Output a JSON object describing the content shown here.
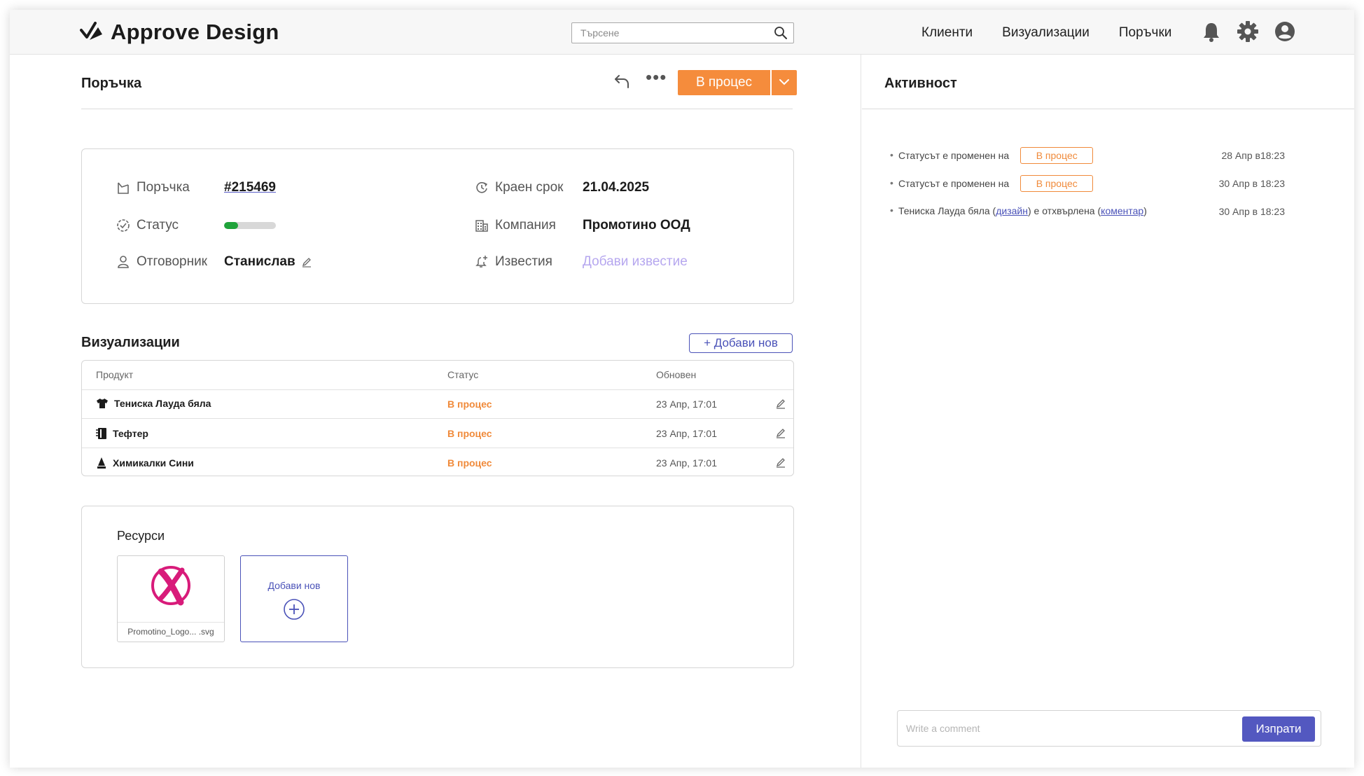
{
  "app": {
    "title": "Approve Design"
  },
  "search": {
    "placeholder": "Търсене"
  },
  "nav": [
    {
      "label": "Клиенти"
    },
    {
      "label": "Визуализации"
    },
    {
      "label": "Поръчки"
    }
  ],
  "order": {
    "heading": "Поръчка",
    "status_button": "В процес",
    "fields": {
      "order_label": "Поръчка",
      "order_value": "#215469",
      "status_label": "Статус",
      "status_progress": 0.27,
      "owner_label": "Отговорник",
      "owner_value": "Станислав",
      "deadline_label": "Краен срок",
      "deadline_value": "21.04.2025",
      "company_label": "Компания",
      "company_value": "Промотино ООД",
      "notices_label": "Известия",
      "notices_value": "Добави известие"
    }
  },
  "visualizations": {
    "title": "Визуализации",
    "add_button": "+ Добави нов",
    "columns": [
      "Продукт",
      "Статус",
      "Обновен"
    ],
    "rows": [
      {
        "product": "Тениска Лауда бяла",
        "icon": "tshirt-icon",
        "status": "В процес",
        "updated": "23 Апр, 17:01"
      },
      {
        "product": "Тефтер",
        "icon": "notebook-icon",
        "status": "В процес",
        "updated": "23 Апр, 17:01"
      },
      {
        "product": "Химикалки Сини",
        "icon": "pen-icon",
        "status": "В процес",
        "updated": "23 Апр, 17:01"
      }
    ]
  },
  "resources": {
    "title": "Ресурси",
    "files": [
      {
        "name": "Promotino_Logo... .svg"
      }
    ],
    "add_label": "Добави нов"
  },
  "activity": {
    "title": "Активност",
    "items": [
      {
        "text": "Статусът е променен на",
        "badge": "В процес",
        "time": "28 Апр в18:23"
      },
      {
        "text": "Статусът е променен на",
        "badge": "В процес",
        "time": "30 Апр в 18:23"
      },
      {
        "prefix": "Тениска Лауда бяла (",
        "link1": "дизайн",
        "middle": ") е отхвърлена (",
        "link2": "коментар",
        "suffix": ")",
        "time": "30 Апр в 18:23"
      }
    ]
  },
  "comment": {
    "placeholder": "Write a comment",
    "send": "Изпрати"
  },
  "colors": {
    "accent": "#f58c3c",
    "primary": "#5358c0",
    "success": "#20a33b",
    "link_muted": "#b6a7ef",
    "logo_mark": "#d81b7a"
  }
}
